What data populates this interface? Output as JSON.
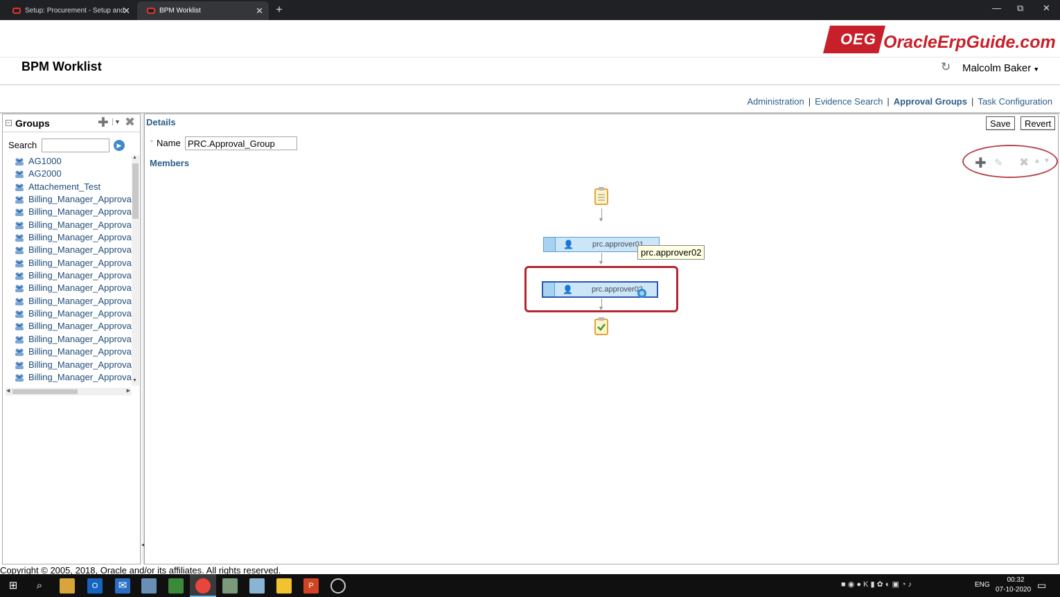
{
  "browser": {
    "tabs": [
      {
        "label": "Setup: Procurement - Setup and"
      },
      {
        "label": "BPM Worklist"
      }
    ],
    "new_tab": "+",
    "window_controls": [
      "—",
      "⧉",
      "✕"
    ]
  },
  "header": {
    "app_title": "BPM Worklist",
    "logo_badge": "OEG",
    "logo_text": "OracleErpGuide.com",
    "user": "Malcolm Baker"
  },
  "nav": {
    "links": [
      "Administration",
      "Evidence Search",
      "Approval Groups",
      "Task Configuration"
    ],
    "active": "Approval Groups",
    "separator": "|"
  },
  "groups_panel": {
    "title": "Groups",
    "search_label": "Search",
    "search_value": "",
    "items": [
      "AG1000",
      "AG2000",
      "Attachement_Test",
      "Billing_Manager_Approval",
      "Billing_Manager_Approval",
      "Billing_Manager_Approval",
      "Billing_Manager_Approval",
      "Billing_Manager_Approval",
      "Billing_Manager_Approval",
      "Billing_Manager_Approval",
      "Billing_Manager_Approval",
      "Billing_Manager_Approval",
      "Billing_Manager_Approval",
      "Billing_Manager_Approval",
      "Billing_Manager_Approval",
      "Billing_Manager_Approval",
      "Billing_Manager_Approval",
      "Billing_Manager_Approval"
    ]
  },
  "details": {
    "title": "Details",
    "save_label": "Save",
    "revert_label": "Revert",
    "required_mark": "*",
    "name_label": "Name",
    "name_value": "PRC.Approval_Group",
    "members_title": "Members",
    "members": [
      {
        "name": "prc.approver01"
      },
      {
        "name": "prc.approver02"
      }
    ],
    "tooltip": "prc.approver02"
  },
  "footer": {
    "copyright": "Copyright © 2005, 2018, Oracle and/or its affiliates. All rights reserved."
  },
  "taskbar": {
    "language": "ENG",
    "time": "00:32",
    "date": "07-10-2020"
  },
  "colors": {
    "link": "#2b5d8a",
    "highlight": "#b3262f",
    "node_fill": "#cde6f7",
    "logo_red": "#c8202a"
  }
}
